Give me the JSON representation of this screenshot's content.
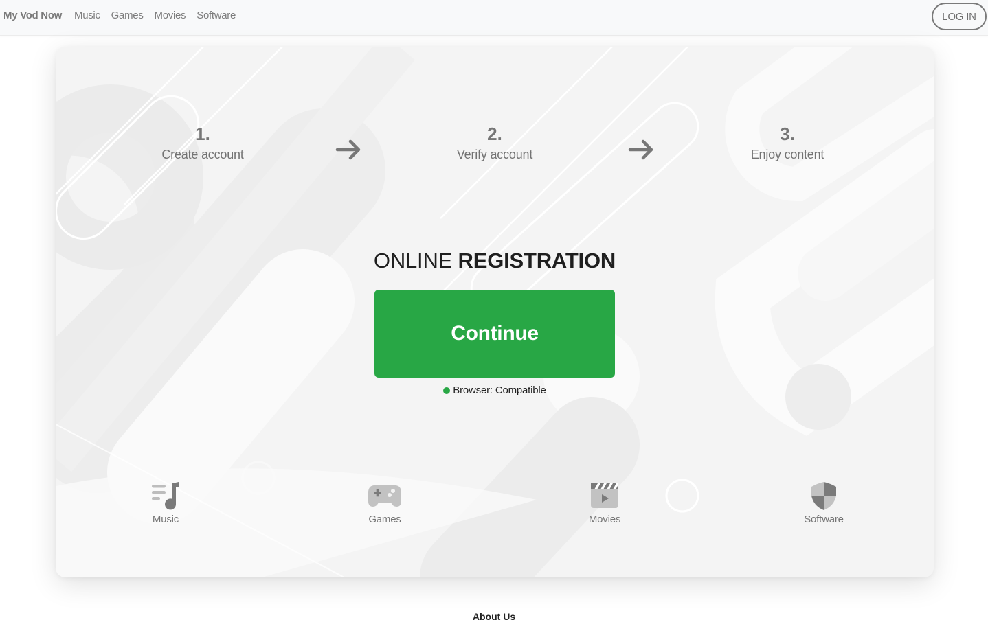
{
  "navbar": {
    "brand": "My Vod Now",
    "links": [
      {
        "label": "Music"
      },
      {
        "label": "Games"
      },
      {
        "label": "Movies"
      },
      {
        "label": "Software"
      }
    ],
    "login_label": "LOG IN"
  },
  "steps": [
    {
      "number": "1.",
      "label": "Create account"
    },
    {
      "number": "2.",
      "label": "Verify account"
    },
    {
      "number": "3.",
      "label": "Enjoy content"
    }
  ],
  "arrows": [
    {
      "icon": "arrow-right-icon"
    },
    {
      "icon": "arrow-right-icon"
    }
  ],
  "registration": {
    "title_light": "ONLINE",
    "title_bold": "REGISTRATION",
    "continue_label": "Continue",
    "status_text": "Browser: Compatible",
    "status_color": "#28a745",
    "button_color": "#28a745"
  },
  "categories": [
    {
      "label": "Music",
      "icon": "music-note-icon"
    },
    {
      "label": "Games",
      "icon": "gamepad-icon"
    },
    {
      "label": "Movies",
      "icon": "clapperboard-icon"
    },
    {
      "label": "Software",
      "icon": "shield-icon"
    }
  ],
  "footer": {
    "heading": "About Us"
  }
}
